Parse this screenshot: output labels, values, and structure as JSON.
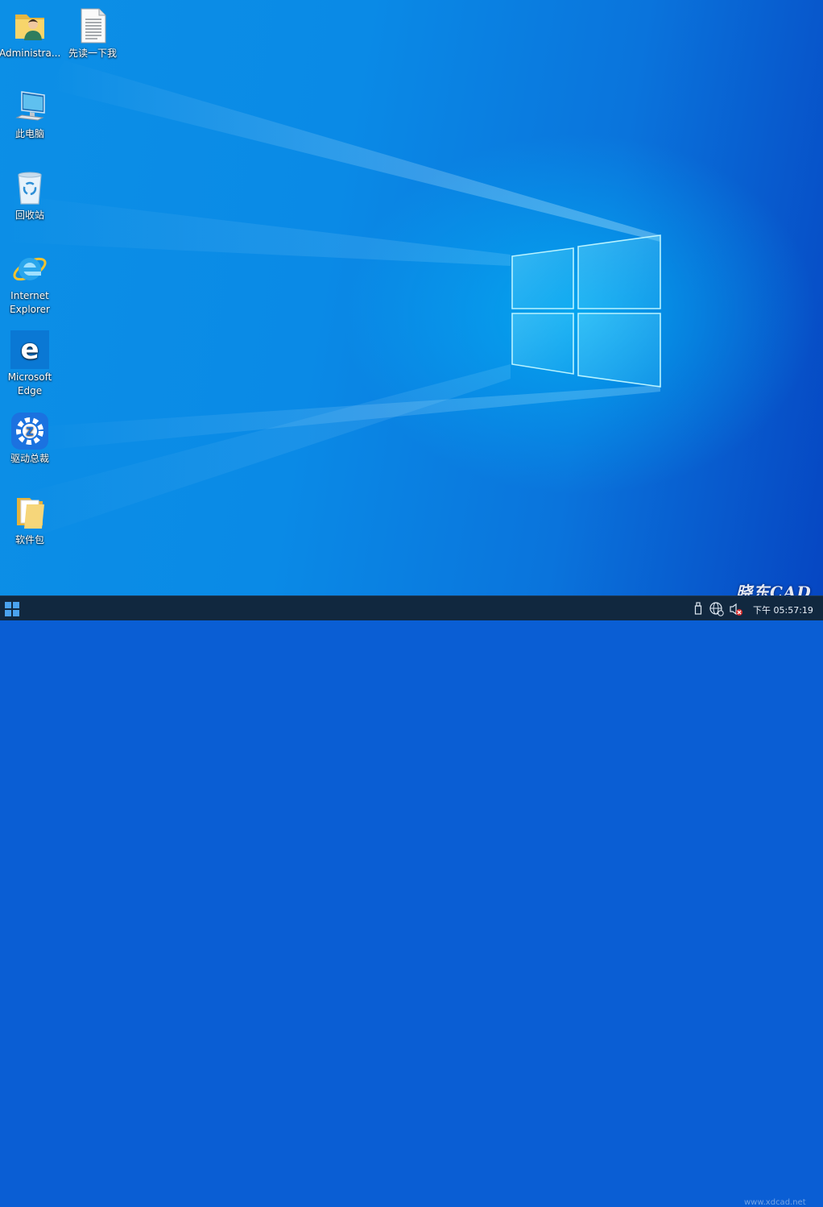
{
  "desktop": {
    "icons": [
      {
        "label": "Administra..."
      },
      {
        "label": "先读一下我"
      },
      {
        "label": "此电脑"
      },
      {
        "label": "回收站"
      },
      {
        "label": "Internet\nExplorer"
      },
      {
        "label": "Microsoft\nEdge"
      },
      {
        "label": "驱动总裁"
      },
      {
        "label": "软件包"
      }
    ]
  },
  "taskbar": {
    "clock": "下午 05:57:19"
  },
  "watermark": {
    "text": "晓东CAD",
    "url": "www.xdcad.net"
  },
  "colors": {
    "taskbar": "#11283f",
    "wallpaper_main": "#0a8ae6",
    "wallpaper_dark": "#0646c2"
  }
}
